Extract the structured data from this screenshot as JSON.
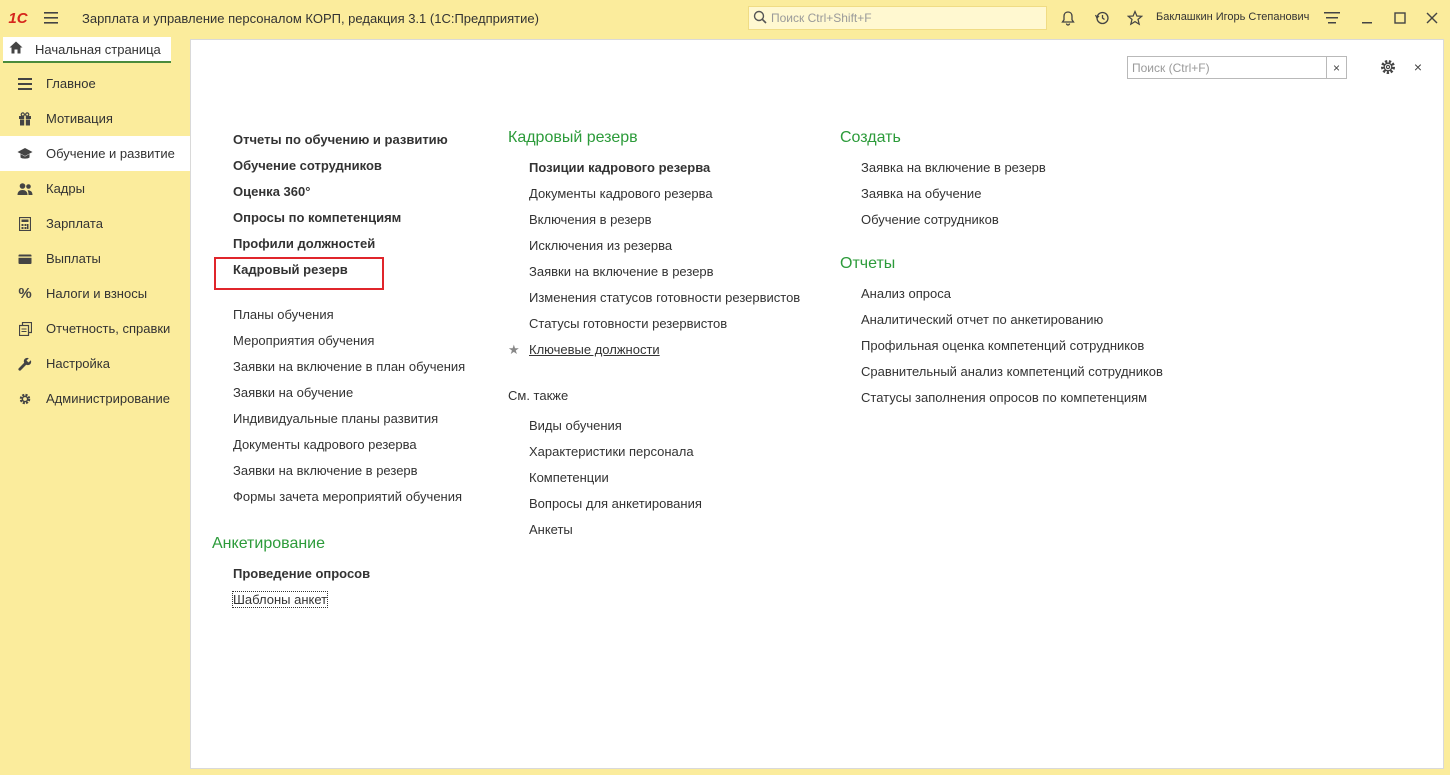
{
  "titlebar": {
    "logo": "1С",
    "app_title": "Зарплата и управление персоналом КОРП, редакция 3.1  (1С:Предприятие)",
    "search_placeholder": "Поиск Ctrl+Shift+F",
    "user_name": "Баклашкин Игорь Степанович",
    "icons": [
      "menu-icon",
      "search-icon",
      "bell-icon",
      "history-icon",
      "star-icon",
      "settings-lines-icon",
      "minimize-icon",
      "maximize-icon",
      "close-icon"
    ]
  },
  "home_tab": {
    "label": "Начальная страница",
    "icon": "home-icon"
  },
  "sidebar": {
    "items": [
      {
        "label": "Главное",
        "icon": "lines-icon"
      },
      {
        "label": "Мотивация",
        "icon": "gift-icon"
      },
      {
        "label": "Обучение и развитие",
        "icon": "graduation-cap-icon",
        "active": true
      },
      {
        "label": "Кадры",
        "icon": "people-icon"
      },
      {
        "label": "Зарплата",
        "icon": "calculator-icon"
      },
      {
        "label": "Выплаты",
        "icon": "wallet-icon"
      },
      {
        "label": "Налоги и взносы",
        "icon": "percent-icon"
      },
      {
        "label": "Отчетность, справки",
        "icon": "documents-icon"
      },
      {
        "label": "Настройка",
        "icon": "wrench-icon"
      },
      {
        "label": "Администрирование",
        "icon": "gear-icon"
      }
    ]
  },
  "main": {
    "search_placeholder": "Поиск (Ctrl+F)",
    "search_clear": "×",
    "close": "×",
    "col1": {
      "bold_links": [
        "Отчеты по обучению и развитию",
        "Обучение сотрудников",
        "Оценка 360°",
        "Опросы по компетенциям",
        "Профили должностей",
        "Кадровый резерв"
      ],
      "links": [
        "Планы обучения",
        "Мероприятия обучения",
        "Заявки на включение в план обучения",
        "Заявки на обучение",
        "Индивидуальные планы развития",
        "Документы кадрового резерва",
        "Заявки на включение в резерв",
        "Формы зачета мероприятий обучения"
      ],
      "survey_title": "Анкетирование",
      "survey_links": [
        "Проведение опросов",
        "Шаблоны анкет"
      ]
    },
    "col2": {
      "title": "Кадровый резерв",
      "bold_link": "Позиции кадрового резерва",
      "links": [
        "Документы кадрового резерва",
        "Включения в резерв",
        "Исключения из резерва",
        "Заявки на включение в резерв",
        "Изменения статусов готовности резервистов",
        "Статусы готовности резервистов"
      ],
      "fav_link": "Ключевые должности",
      "see_also_title": "См. также",
      "see_also_links": [
        "Виды обучения",
        "Характеристики персонала",
        "Компетенции",
        "Вопросы для анкетирования",
        "Анкеты"
      ]
    },
    "col3": {
      "create_title": "Создать",
      "create_links": [
        "Заявка на включение в резерв",
        "Заявка на обучение",
        "Обучение сотрудников"
      ],
      "reports_title": "Отчеты",
      "reports_links": [
        "Анализ опроса",
        "Аналитический отчет по анкетированию",
        "Профильная оценка компетенций сотрудников",
        "Сравнительный анализ компетенций сотрудников",
        "Статусы заполнения опросов по компетенциям"
      ]
    }
  },
  "colors": {
    "accent_green": "#2c9b3a",
    "sidebar_bg": "#fbec9c",
    "highlight_red": "#e0252b"
  }
}
